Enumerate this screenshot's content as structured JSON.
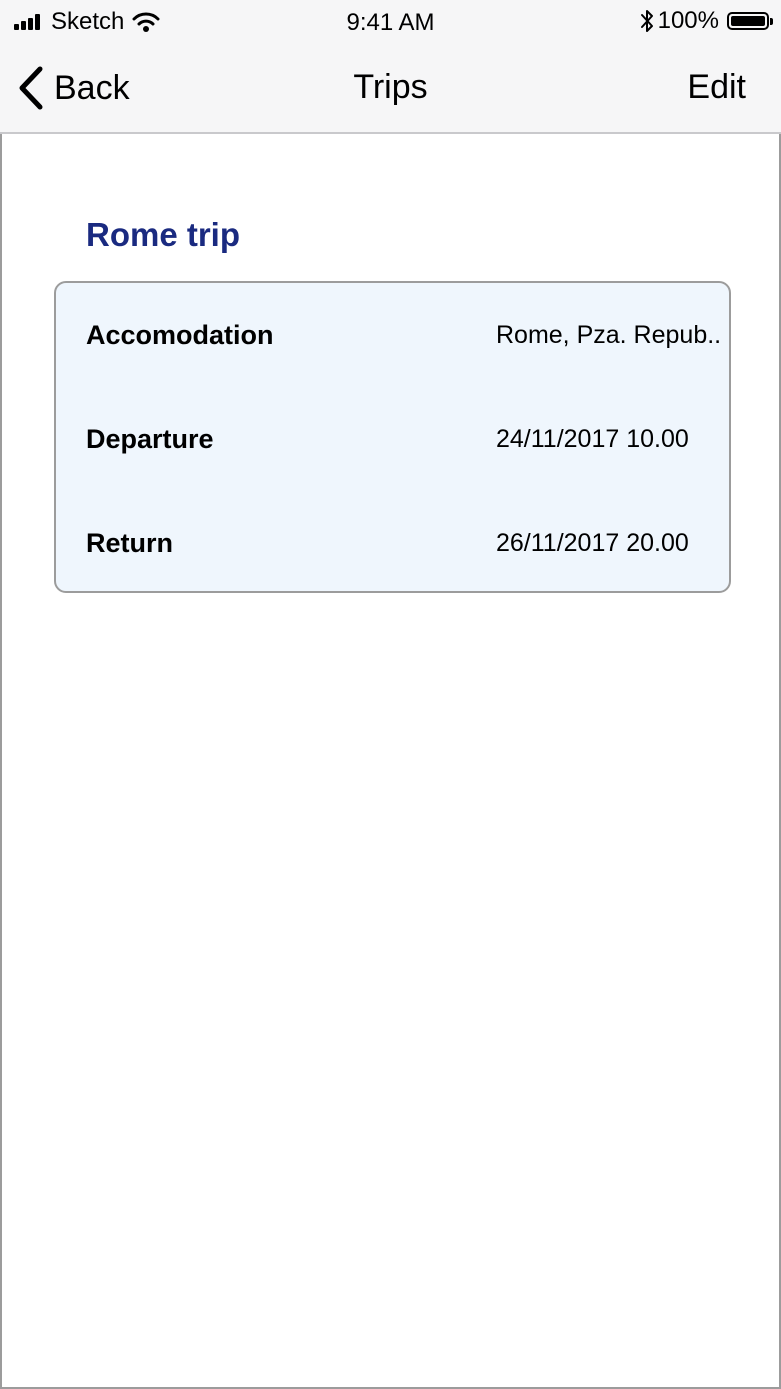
{
  "status_bar": {
    "carrier": "Sketch",
    "time": "9:41 AM",
    "battery": "100%",
    "icons": [
      "signal-icon",
      "wifi-icon",
      "bluetooth-icon",
      "battery-icon"
    ]
  },
  "nav": {
    "back_label": "Back",
    "title": "Trips",
    "edit_label": "Edit"
  },
  "trip": {
    "title": "Rome trip",
    "rows": [
      {
        "label": "Accomodation",
        "value": "Rome, Pza. Repub.."
      },
      {
        "label": "Departure",
        "value": "24/11/2017 10.00"
      },
      {
        "label": "Return",
        "value": "26/11/2017 20.00"
      }
    ]
  },
  "colors": {
    "title": "#1a2a80",
    "card_bg": "#eff6fd",
    "bar_bg": "#f6f6f7",
    "border": "#9c9c9c"
  }
}
